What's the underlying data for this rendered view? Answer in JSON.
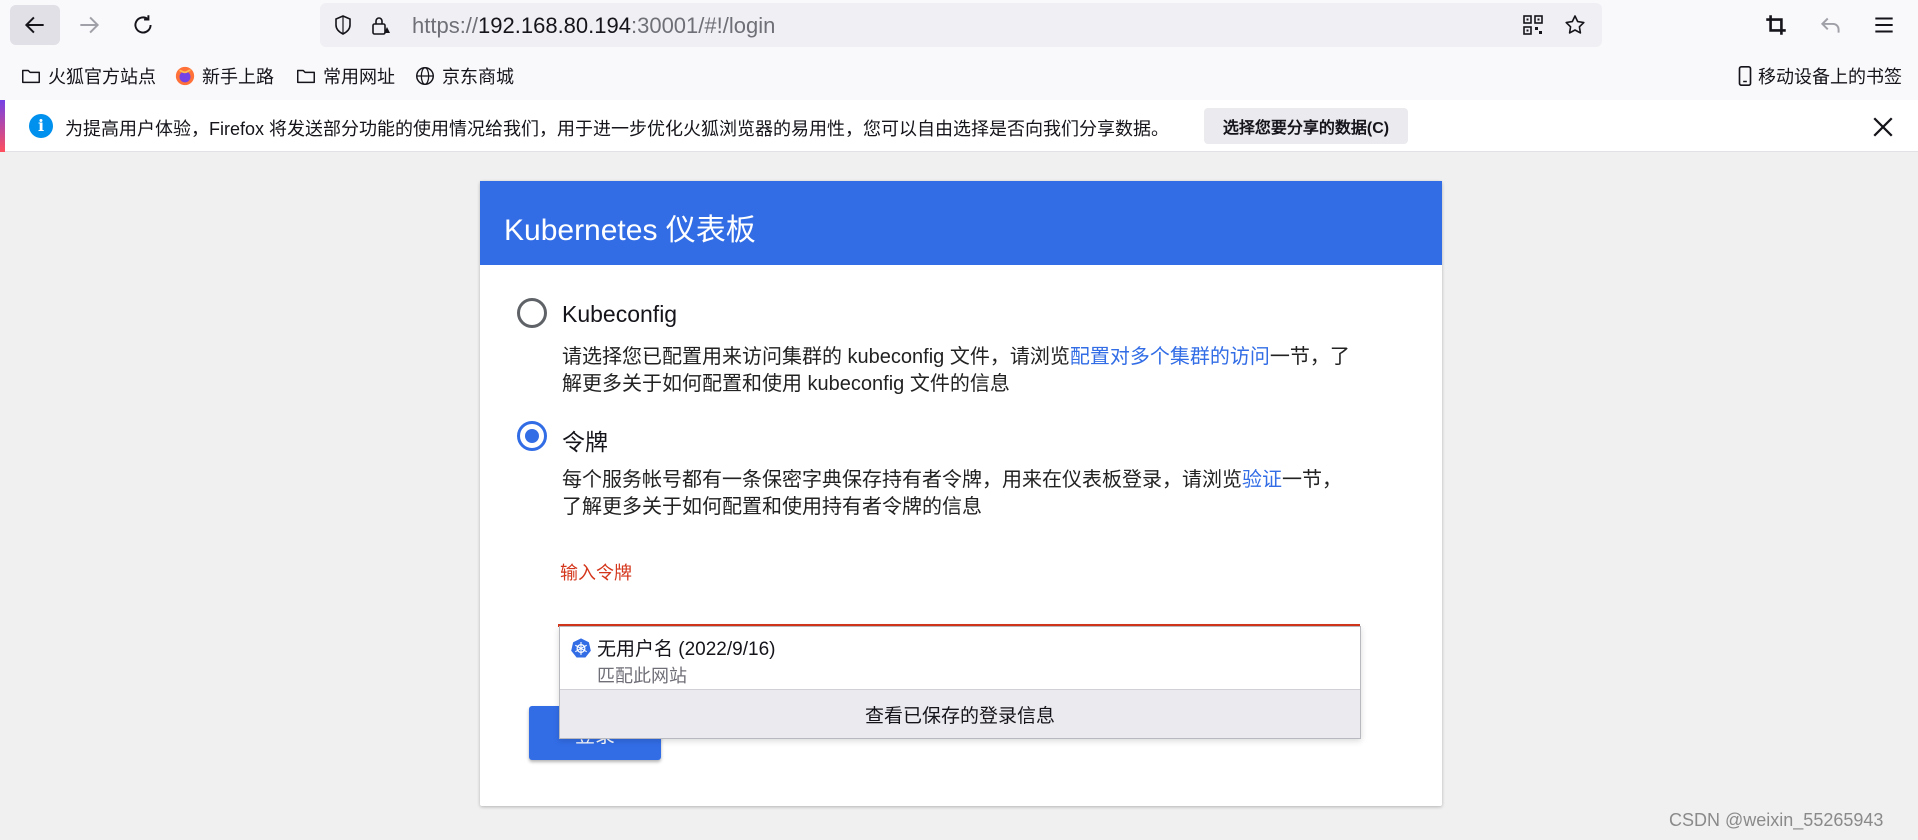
{
  "browser": {
    "url_scheme": "https://",
    "url_host": "192.168.80.194",
    "url_rest": ":30001/#!/login",
    "icons": [
      "back-arrow-icon",
      "forward-arrow-icon",
      "reload-icon",
      "shield-icon",
      "lock-icon",
      "qr-code-icon",
      "star-icon",
      "crop-icon",
      "undo-icon",
      "menu-icon"
    ]
  },
  "bookmarks": {
    "items": [
      {
        "label": "火狐官方站点",
        "icon": "folder-icon"
      },
      {
        "label": "新手上路",
        "icon": "firefox-icon"
      },
      {
        "label": "常用网址",
        "icon": "folder-icon"
      },
      {
        "label": "京东商城",
        "icon": "globe-icon"
      }
    ],
    "mobile": {
      "label": "移动设备上的书签",
      "icon": "mobile-icon"
    }
  },
  "notification": {
    "text": "为提高用户体验，Firefox 将发送部分功能的使用情况给我们，用于进一步优化火狐浏览器的易用性，您可以自由选择是否向我们分享数据。",
    "button": "选择您要分享的数据(C)",
    "info_icon": "i"
  },
  "dashboard": {
    "title": "Kubernetes 仪表板",
    "options": [
      {
        "label": "Kubeconfig",
        "checked": false,
        "desc_before": "请选择您已配置用来访问集群的 kubeconfig 文件，请浏览",
        "desc_link": "配置对多个集群的访问",
        "desc_after": "一节，了解更多关于如何配置和使用 kubeconfig 文件的信息"
      },
      {
        "label": "令牌",
        "checked": true,
        "desc_before": "每个服务帐号都有一条保密字典保存持有者令牌，用来在仪表板登录，请浏览",
        "desc_link": "验证",
        "desc_after": "一节，了解更多关于如何配置和使用持有者令牌的信息"
      }
    ],
    "token_label": "输入令牌",
    "login_button": "登录"
  },
  "autocomplete": {
    "username": "无用户名 (2022/9/16)",
    "site_match": "匹配此网站",
    "footer": "查看已保存的登录信息"
  },
  "watermark": "CSDN @weixin_55265943",
  "colors": {
    "accent": "#326de6",
    "error": "#d4361b"
  }
}
